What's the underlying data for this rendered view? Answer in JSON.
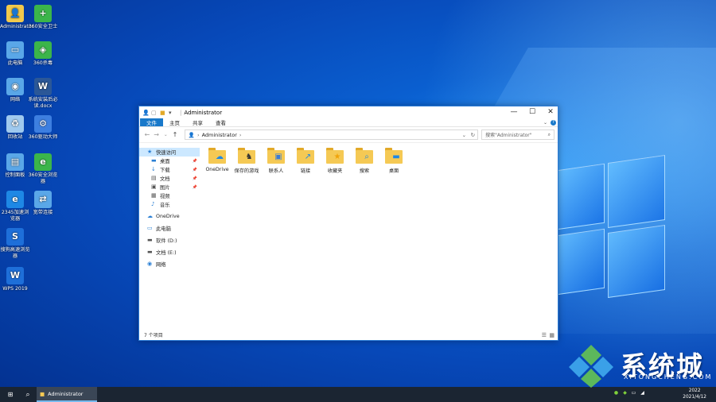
{
  "desktop": {
    "icons": [
      {
        "label": "Administrator",
        "icon": "user-folder-icon",
        "color": "#f2c94c"
      },
      {
        "label": "360安全卫士",
        "icon": "360-security-icon",
        "color": "#3bb54a"
      },
      {
        "label": "此电脑",
        "icon": "computer-icon",
        "color": "#5aa7e8"
      },
      {
        "label": "360杀毒",
        "icon": "360-antivirus-icon",
        "color": "#3bb54a"
      },
      {
        "label": "网络",
        "icon": "network-icon",
        "color": "#5aa7e8"
      },
      {
        "label": "系统安装后必读.docx",
        "icon": "word-doc-icon",
        "color": "#2b5797"
      },
      {
        "label": "回收站",
        "icon": "recycle-bin-icon",
        "color": "#9fc9ee"
      },
      {
        "label": "360驱动大师",
        "icon": "driver-master-icon",
        "color": "#3d7fe0"
      },
      {
        "label": "控制面板",
        "icon": "control-panel-icon",
        "color": "#5aa7e8"
      },
      {
        "label": "360安全浏览器",
        "icon": "360-browser-icon",
        "color": "#3bb54a"
      },
      {
        "label": "2345加速浏览器",
        "icon": "2345-browser-icon",
        "color": "#1e88e5"
      },
      {
        "label": "宽带连接",
        "icon": "broadband-icon",
        "color": "#5aa7e8"
      },
      {
        "label": "搜狗高速浏览器",
        "icon": "sogou-browser-icon",
        "color": "#1e6fd9"
      },
      {
        "label": "WPS 2019",
        "icon": "wps-icon",
        "color": "#1e6fd9"
      }
    ]
  },
  "window": {
    "title": "Administrator",
    "tabs": [
      "文件",
      "主页",
      "共享",
      "查看"
    ],
    "address": {
      "path": "Administrator",
      "separator": "›"
    },
    "search": {
      "placeholder": "搜索\"Administrator\""
    },
    "sidebar": [
      {
        "label": "快速访问",
        "icon": "star-icon",
        "level": 0,
        "selected": true
      },
      {
        "label": "桌面",
        "icon": "desktop-icon",
        "level": 1,
        "pinned": true
      },
      {
        "label": "下载",
        "icon": "download-icon",
        "level": 1,
        "pinned": true
      },
      {
        "label": "文档",
        "icon": "document-icon",
        "level": 1,
        "pinned": true
      },
      {
        "label": "图片",
        "icon": "picture-icon",
        "level": 1,
        "pinned": true
      },
      {
        "label": "视频",
        "icon": "video-icon",
        "level": 1
      },
      {
        "label": "音乐",
        "icon": "music-icon",
        "level": 1
      },
      {
        "label": "OneDrive",
        "icon": "cloud-icon",
        "level": 0
      },
      {
        "label": "此电脑",
        "icon": "computer-icon",
        "level": 0
      },
      {
        "label": "软件 (D:)",
        "icon": "drive-icon",
        "level": 0
      },
      {
        "label": "文档 (E:)",
        "icon": "drive-icon",
        "level": 0
      },
      {
        "label": "网络",
        "icon": "network-icon",
        "level": 0
      }
    ],
    "items": [
      {
        "label": "OneDrive",
        "icon": "onedrive-folder-icon"
      },
      {
        "label": "保存的游戏",
        "icon": "saved-games-folder-icon"
      },
      {
        "label": "联系人",
        "icon": "contacts-folder-icon"
      },
      {
        "label": "链接",
        "icon": "links-folder-icon"
      },
      {
        "label": "收藏夹",
        "icon": "favorites-folder-icon"
      },
      {
        "label": "搜索",
        "icon": "searches-folder-icon"
      },
      {
        "label": "桌面",
        "icon": "desktop-folder-icon"
      }
    ],
    "status": "7 个项目"
  },
  "taskbar": {
    "app_label": "Administrator",
    "time": "2022",
    "date": "2021/4/12"
  },
  "watermark": {
    "title": "系统城",
    "subtitle": "XITONGCHENG.COM"
  }
}
